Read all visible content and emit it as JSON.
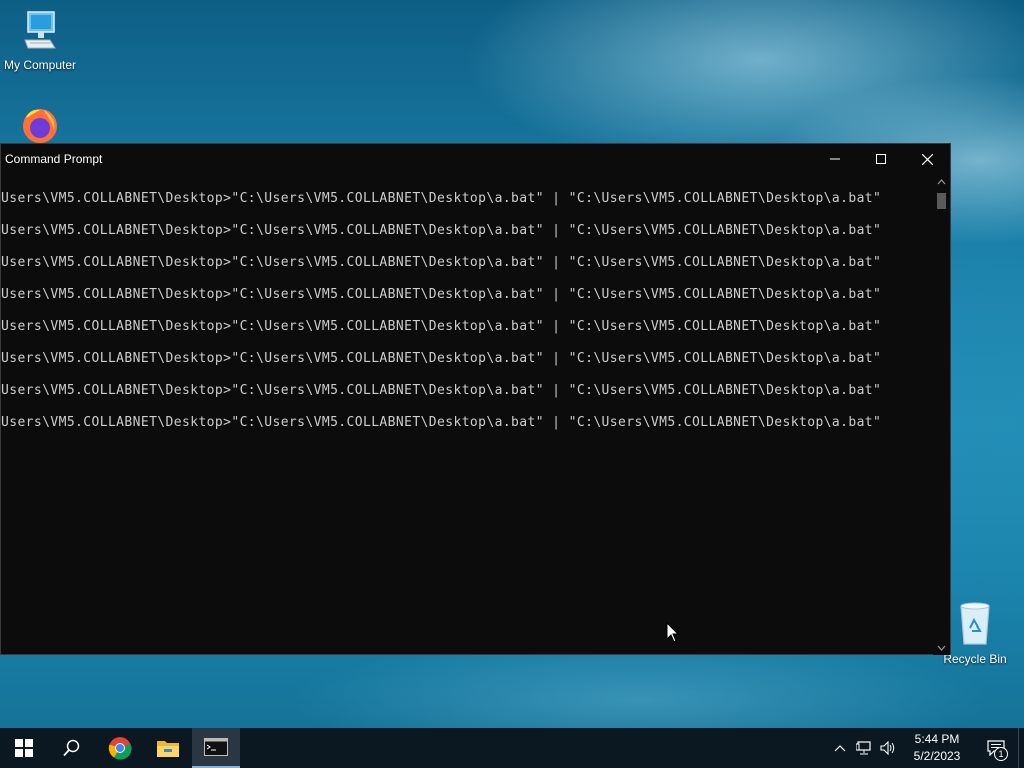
{
  "desktop": {
    "icons": [
      {
        "label": "My Computer",
        "icon": "computer-icon"
      },
      {
        "label": "",
        "icon": "firefox-icon"
      },
      {
        "label": "Recycle Bin",
        "icon": "recycle-bin-icon"
      }
    ]
  },
  "window": {
    "title": "Command Prompt",
    "controls": [
      "minimize",
      "maximize",
      "close"
    ],
    "background": "#0c0c0c",
    "text_color": "#cccccc",
    "lines": [
      "Users\\VM5.COLLABNET\\Desktop>\"C:\\Users\\VM5.COLLABNET\\Desktop\\a.bat\" | \"C:\\Users\\VM5.COLLABNET\\Desktop\\a.bat\"",
      "Users\\VM5.COLLABNET\\Desktop>\"C:\\Users\\VM5.COLLABNET\\Desktop\\a.bat\" | \"C:\\Users\\VM5.COLLABNET\\Desktop\\a.bat\"",
      "Users\\VM5.COLLABNET\\Desktop>\"C:\\Users\\VM5.COLLABNET\\Desktop\\a.bat\" | \"C:\\Users\\VM5.COLLABNET\\Desktop\\a.bat\"",
      "Users\\VM5.COLLABNET\\Desktop>\"C:\\Users\\VM5.COLLABNET\\Desktop\\a.bat\" | \"C:\\Users\\VM5.COLLABNET\\Desktop\\a.bat\"",
      "Users\\VM5.COLLABNET\\Desktop>\"C:\\Users\\VM5.COLLABNET\\Desktop\\a.bat\" | \"C:\\Users\\VM5.COLLABNET\\Desktop\\a.bat\"",
      "Users\\VM5.COLLABNET\\Desktop>\"C:\\Users\\VM5.COLLABNET\\Desktop\\a.bat\" | \"C:\\Users\\VM5.COLLABNET\\Desktop\\a.bat\"",
      "Users\\VM5.COLLABNET\\Desktop>\"C:\\Users\\VM5.COLLABNET\\Desktop\\a.bat\" | \"C:\\Users\\VM5.COLLABNET\\Desktop\\a.bat\"",
      "Users\\VM5.COLLABNET\\Desktop>\"C:\\Users\\VM5.COLLABNET\\Desktop\\a.bat\" | \"C:\\Users\\VM5.COLLABNET\\Desktop\\a.bat\""
    ]
  },
  "taskbar": {
    "buttons": [
      "windows-start-icon",
      "search-icon",
      "chrome-icon",
      "file-explorer-icon",
      "command-prompt-icon"
    ],
    "active": "command-prompt-icon",
    "tray": {
      "icons": [
        "chevron-up-icon",
        "network-icon",
        "volume-icon"
      ],
      "time": "5:44 PM",
      "date": "5/2/2023",
      "notification_count": "1"
    }
  }
}
